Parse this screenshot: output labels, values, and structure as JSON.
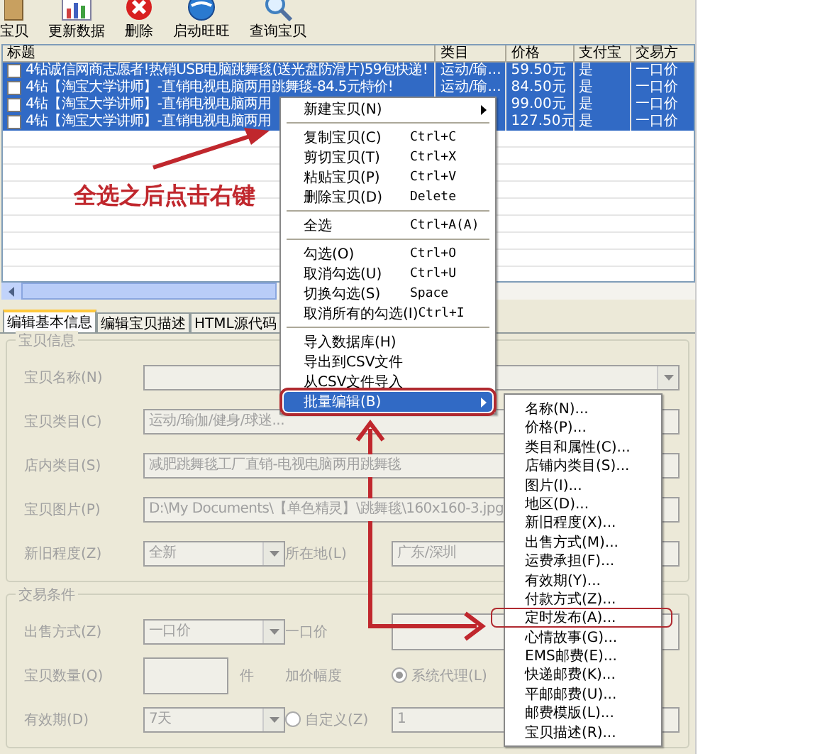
{
  "toolbar": [
    {
      "kind": "box",
      "label": "宝贝"
    },
    {
      "kind": "chart",
      "label": "更新数据"
    },
    {
      "kind": "delete",
      "label": "删除"
    },
    {
      "kind": "globe",
      "label": "启动旺旺"
    },
    {
      "kind": "search",
      "label": "查询宝贝"
    }
  ],
  "grid": {
    "columns": [
      "标题",
      "类目",
      "价格",
      "支付宝",
      "交易方"
    ],
    "rows": [
      {
        "selected": true,
        "checked": false,
        "cells": [
          "4钻诚信网商志愿者!热销USB电脑跳舞毯(送光盘防滑片)59包快递!",
          "运动/瑜...",
          "59.50元",
          "是",
          "一口价"
        ]
      },
      {
        "selected": true,
        "checked": false,
        "cells": [
          "4钻【淘宝大学讲师】-直销电视电脑两用跳舞毯-84.5元特价!",
          "运动/瑜...",
          "84.50元",
          "是",
          "一口价"
        ]
      },
      {
        "selected": true,
        "checked": false,
        "cells": [
          "4钻【淘宝大学讲师】-直销电视电脑两用",
          null,
          "99.00元",
          "是",
          "一口价"
        ]
      },
      {
        "selected": true,
        "checked": false,
        "cells": [
          "4钻【淘宝大学讲师】-直销电视电脑两用",
          null,
          "127.50元",
          "是",
          "一口价"
        ]
      }
    ]
  },
  "tabs": [
    {
      "label": "编辑基本信息",
      "selected": true
    },
    {
      "label": "编辑宝贝描述",
      "selected": false
    },
    {
      "label": "HTML源代码",
      "selected": false
    }
  ],
  "form": {
    "disabled": true,
    "groups": [
      {
        "title": "宝贝信息",
        "rows": [
          [
            {
              "kind": "label",
              "text": "宝贝名称(N)"
            },
            {
              "kind": "combo"
            }
          ],
          [
            {
              "kind": "label",
              "text": "宝贝类目(C)"
            },
            {
              "kind": "text",
              "value": "运动/瑜伽/健身/球迷..."
            }
          ],
          [
            {
              "kind": "label",
              "text": "店内类目(S)"
            },
            {
              "kind": "text",
              "value": "减肥跳舞毯工厂直销-电视电脑两用跳舞毯"
            }
          ],
          [
            {
              "kind": "label",
              "text": "宝贝图片(P)"
            },
            {
              "kind": "text",
              "value": "D:\\My Documents\\【单色精灵】\\跳舞毯\\160x160-3.jpg"
            }
          ],
          [
            {
              "kind": "label",
              "text": "新旧程度(Z)"
            },
            {
              "kind": "select",
              "value": "全新"
            },
            {
              "kind": "label",
              "text": "所在地(L)"
            },
            {
              "kind": "input",
              "value": "广东/深圳"
            }
          ]
        ]
      },
      {
        "title": "交易条件",
        "rows": [
          [
            {
              "kind": "label",
              "text": "出售方式(Z)"
            },
            {
              "kind": "select",
              "value": "一口价"
            },
            {
              "kind": "label",
              "text": "一口价"
            },
            {
              "kind": "input"
            }
          ],
          [
            {
              "kind": "label",
              "text": "宝贝数量(Q)"
            },
            {
              "kind": "input",
              "unit": "件"
            },
            {
              "kind": "label",
              "text": "加价幅度"
            },
            {
              "kind": "radio",
              "text": "系统代理(L)",
              "checked": true
            }
          ],
          [
            {
              "kind": "label",
              "text": "有效期(D)"
            },
            {
              "kind": "select",
              "value": "7天"
            },
            {
              "kind": "radio",
              "text": "自定义(Z)",
              "checked": false
            },
            {
              "kind": "input",
              "value": "1"
            }
          ]
        ]
      }
    ]
  },
  "context_menu": {
    "items": [
      {
        "kind": "item",
        "label": "新建宝贝(N)",
        "submenu": true,
        "highlighted": false,
        "outlined": false
      },
      {
        "kind": "separator"
      },
      {
        "kind": "item",
        "label": "复制宝贝(C)",
        "shortcut": "Ctrl+C",
        "submenu": false,
        "highlighted": false,
        "outlined": false
      },
      {
        "kind": "item",
        "label": "剪切宝贝(T)",
        "shortcut": "Ctrl+X",
        "submenu": false,
        "highlighted": false,
        "outlined": false
      },
      {
        "kind": "item",
        "label": "粘贴宝贝(P)",
        "shortcut": "Ctrl+V",
        "submenu": false,
        "highlighted": false,
        "outlined": false
      },
      {
        "kind": "item",
        "label": "删除宝贝(D)",
        "shortcut": "Delete",
        "submenu": false,
        "highlighted": false,
        "outlined": false
      },
      {
        "kind": "separator"
      },
      {
        "kind": "item",
        "label": "全选",
        "shortcut": "Ctrl+A(A)",
        "submenu": false,
        "highlighted": false,
        "outlined": false
      },
      {
        "kind": "separator"
      },
      {
        "kind": "item",
        "label": "勾选(O)",
        "shortcut": "Ctrl+O",
        "submenu": false,
        "highlighted": false,
        "outlined": false
      },
      {
        "kind": "item",
        "label": "取消勾选(U)",
        "shortcut": "Ctrl+U",
        "submenu": false,
        "highlighted": false,
        "outlined": false
      },
      {
        "kind": "item",
        "label": "切换勾选(S)",
        "shortcut": "Space",
        "submenu": false,
        "highlighted": false,
        "outlined": false
      },
      {
        "kind": "item",
        "label": "取消所有的勾选(I)",
        "shortcut": "Ctrl+I",
        "submenu": false,
        "highlighted": false,
        "outlined": false
      },
      {
        "kind": "separator"
      },
      {
        "kind": "item",
        "label": "导入数据库(H)",
        "submenu": false,
        "highlighted": false,
        "outlined": false
      },
      {
        "kind": "item",
        "label": "导出到CSV文件",
        "submenu": false,
        "highlighted": false,
        "outlined": false
      },
      {
        "kind": "item",
        "label": "从CSV文件导入",
        "submenu": false,
        "highlighted": false,
        "outlined": false
      },
      {
        "kind": "item",
        "label": "批量编辑(B)",
        "submenu": true,
        "highlighted": true,
        "outlined": true
      }
    ]
  },
  "submenu": {
    "items": [
      {
        "label": "名称(N)...",
        "outlined": false
      },
      {
        "label": "价格(P)...",
        "outlined": false
      },
      {
        "label": "类目和属性(C)...",
        "outlined": false
      },
      {
        "label": "店铺内类目(S)...",
        "outlined": false
      },
      {
        "label": "图片(I)...",
        "outlined": false
      },
      {
        "label": "地区(D)...",
        "outlined": false
      },
      {
        "label": "新旧程度(X)...",
        "outlined": false
      },
      {
        "label": "出售方式(M)...",
        "outlined": false
      },
      {
        "label": "运费承担(F)...",
        "outlined": false
      },
      {
        "label": "有效期(Y)...",
        "outlined": false
      },
      {
        "label": "付款方式(Z)...",
        "outlined": false
      },
      {
        "label": "定时发布(A)...",
        "outlined": true
      },
      {
        "label": "心情故事(G)...",
        "outlined": false
      },
      {
        "label": "EMS邮费(E)...",
        "outlined": false
      },
      {
        "label": "快递邮费(K)...",
        "outlined": false
      },
      {
        "label": "平邮邮费(U)...",
        "outlined": false
      },
      {
        "label": "邮费模版(L)...",
        "outlined": false
      },
      {
        "label": "宝贝描述(R)...",
        "outlined": false
      }
    ]
  },
  "annotation": {
    "text": "全选之后点击右键"
  }
}
